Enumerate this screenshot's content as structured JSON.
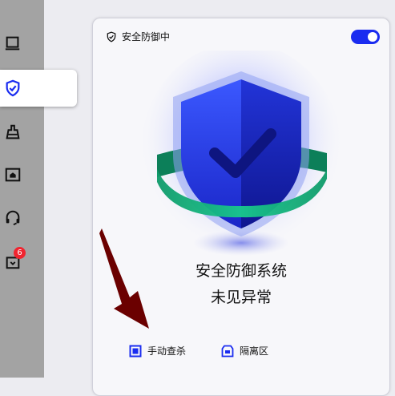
{
  "sidebar": {
    "items": [
      {
        "icon": "laptop-icon"
      },
      {
        "icon": "shield-check-icon",
        "active": true
      },
      {
        "icon": "broom-icon"
      },
      {
        "icon": "toolbox-icon"
      },
      {
        "icon": "headset-icon"
      },
      {
        "icon": "bag-icon",
        "badge": "6"
      }
    ]
  },
  "protection": {
    "status_label": "安全防御中",
    "toggle_on": true
  },
  "main": {
    "system_title": "安全防御系统",
    "system_status": "未见异常"
  },
  "actions": {
    "manual_scan_label": "手动查杀",
    "quarantine_label": "隔离区"
  },
  "colors": {
    "accent": "#1a2cf0",
    "sidebar_bg": "#a3a3a3",
    "arrow": "#6b0000"
  }
}
